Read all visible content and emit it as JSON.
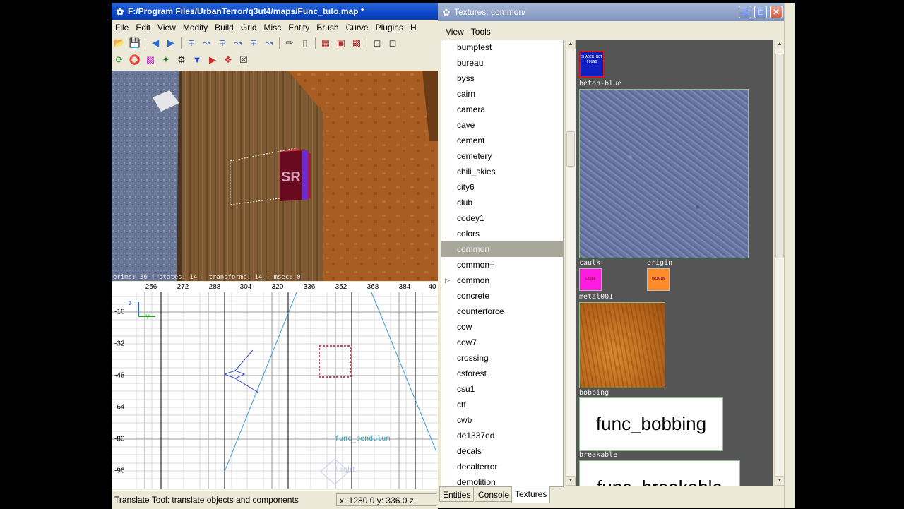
{
  "editor": {
    "title": "F:/Program Files/UrbanTerror/q3ut4/maps/Func_tuto.map *",
    "menus": [
      "File",
      "Edit",
      "View",
      "Modify",
      "Build",
      "Grid",
      "Misc",
      "Entity",
      "Brush",
      "Curve",
      "Plugins",
      "H"
    ],
    "viewport_stats": "prims: 36 | states: 14 | transforms: 14 | msec: 0",
    "cube_label": "SR",
    "grid": {
      "x_ticks": [
        "256",
        "272",
        "288",
        "304",
        "320",
        "336",
        "352",
        "368",
        "384",
        "40"
      ],
      "y_ticks": [
        "-16",
        "-32",
        "-48",
        "-64",
        "-80",
        "-96"
      ],
      "axis_z": "z",
      "axis_y": "Y",
      "entity_label": "func_pendulum",
      "light_label": "light"
    },
    "status_text": "Translate Tool: translate objects and components",
    "coords": "x: 1280.0 y: 336.0 z:"
  },
  "texwin": {
    "title": "Textures: common/",
    "menus": [
      "View",
      "Tools"
    ],
    "list": [
      "bumptest",
      "bureau",
      "byss",
      "cairn",
      "camera",
      "cave",
      "cement",
      "cemetery",
      "chili_skies",
      "city6",
      "club",
      "codey1",
      "colors",
      "common",
      "common+",
      "common",
      "concrete",
      "counterforce",
      "cow",
      "cow7",
      "crossing",
      "csforest",
      "csu1",
      "ctf",
      "cwb",
      "de1337ed",
      "decals",
      "decalterror",
      "demolition"
    ],
    "selected_index": 13,
    "expander_index": 15,
    "textures": {
      "notfound_text": "SHADER NOT FOUND",
      "beton": "beton-blue",
      "caulk": "caulk",
      "caulk_thumb": "CAULK",
      "origin": "origin",
      "origin_thumb": "ORIGIN",
      "metal": "metal001",
      "bobbing": "bobbing",
      "bobbing_thumb": "func_bobbing",
      "breakable": "breakable",
      "breakable_thumb": "func_breakable"
    },
    "tabs": [
      "Entities",
      "Console",
      "Textures"
    ],
    "active_tab": 2
  }
}
